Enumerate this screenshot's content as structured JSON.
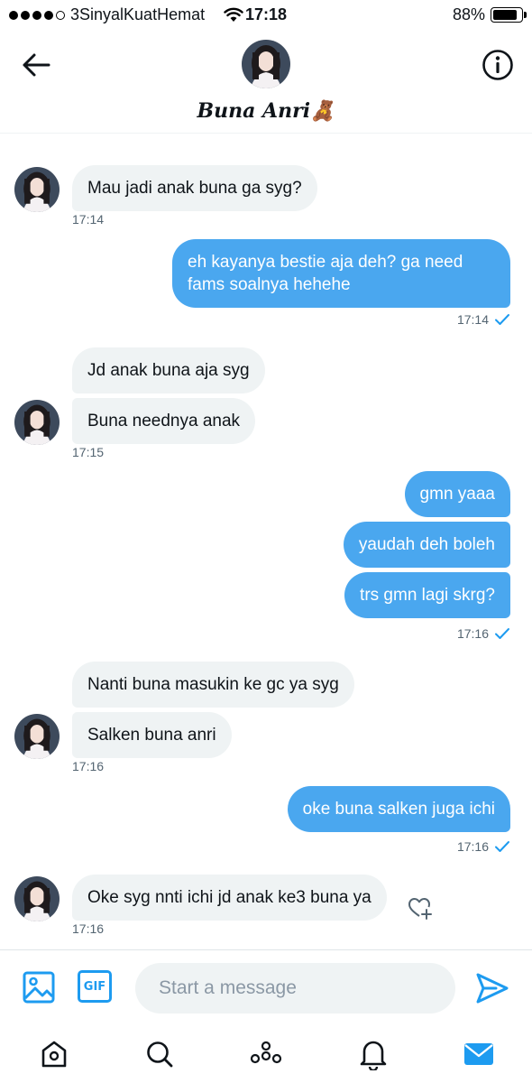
{
  "status_bar": {
    "carrier": "3SinyalKuatHemat",
    "time": "17:18",
    "battery_text": "88%",
    "battery_level": 0.88,
    "signal_bars_filled": 4,
    "signal_bars_total": 5
  },
  "header": {
    "contact_name": "Buna Anri🧸",
    "back_icon": "arrow-left-icon",
    "info_icon": "info-icon"
  },
  "messages": [
    {
      "direction": "in",
      "text": "Mau jadi anak buna ga syg?"
    },
    {
      "direction": "in",
      "time": "17:14"
    },
    {
      "direction": "out",
      "text": "eh kayanya bestie aja deh? ga need fams soalnya hehehe"
    },
    {
      "direction": "out",
      "time": "17:14",
      "status_icon": "check-icon"
    },
    {
      "direction": "in",
      "text": "Jd anak buna aja syg"
    },
    {
      "direction": "in",
      "text": "Buna neednya anak"
    },
    {
      "direction": "in",
      "time": "17:15"
    },
    {
      "direction": "out",
      "text": "gmn yaaa"
    },
    {
      "direction": "out",
      "text": "yaudah deh boleh"
    },
    {
      "direction": "out",
      "text": "trs gmn lagi skrg?"
    },
    {
      "direction": "out",
      "time": "17:16",
      "status_icon": "check-icon"
    },
    {
      "direction": "in",
      "text": "Nanti buna masukin ke gc ya syg"
    },
    {
      "direction": "in",
      "text": "Salken buna anri"
    },
    {
      "direction": "in",
      "time": "17:16"
    },
    {
      "direction": "out",
      "text": "oke buna salken juga ichi"
    },
    {
      "direction": "out",
      "time": "17:16",
      "status_icon": "check-icon"
    },
    {
      "direction": "in",
      "text": "Oke syg nnti ichi jd anak ke3 buna ya"
    },
    {
      "direction": "in",
      "time": "17:16"
    }
  ],
  "composer": {
    "placeholder": "Start a message",
    "gif_label": "GIF",
    "value": ""
  },
  "tab_bar": {
    "items": [
      "home-icon",
      "search-icon",
      "spaces-icon",
      "notifications-icon",
      "messages-icon"
    ],
    "active": "messages-icon"
  },
  "colors": {
    "outgoing_bubble": "#4aa7ef",
    "incoming_bubble": "#eff3f4",
    "accent": "#1d9bf0"
  }
}
